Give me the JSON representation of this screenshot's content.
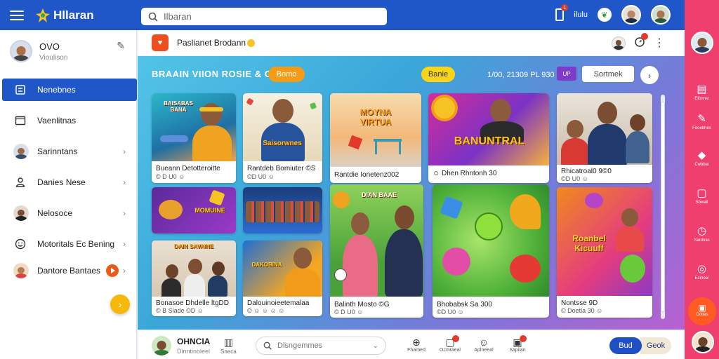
{
  "app": {
    "title": "Hllaran",
    "search_placeholder": "Ilbaran"
  },
  "topbar": {
    "notif_count": "1",
    "text_label": "ilulu"
  },
  "profile": {
    "name": "OVO",
    "subtitle": "Vioulison"
  },
  "sidebar": {
    "items": [
      {
        "label": "Nenebnes",
        "icon": "home-icon",
        "active": true
      },
      {
        "label": "Vaenlitnas",
        "icon": "window-icon"
      },
      {
        "label": "Sarinntans",
        "icon": "avatar"
      },
      {
        "label": "Danies Nese",
        "icon": "person-icon"
      },
      {
        "label": "Nelosoce",
        "icon": "avatar"
      },
      {
        "label": "Motoritals Ec Bening",
        "icon": "smile-icon"
      },
      {
        "label": "Dantore Bantaes",
        "icon": "avatar",
        "live": true
      }
    ]
  },
  "channel": {
    "title": "Paslianet Brodann"
  },
  "toolbar": {
    "banner": "BRAAIN VIION ROSIE & OG",
    "orange_pill": "Bomo",
    "yellow_pill": "Banie",
    "date": "1/00, 21309 PL 930",
    "purple_btn": "UP",
    "sort_label": "Sortmek"
  },
  "cards": [
    {
      "thumb_title": "BAISABAS BANA",
      "caption": "Bueann Detotteroitte",
      "meta": "© D U0 ☺"
    },
    {
      "thumb_title": "Saisorwnes",
      "caption": "Rantdeb Bomiuter ©S",
      "meta": "©D U0 ☺"
    },
    {
      "thumb_title": "MOYNA VIRTUA",
      "caption": "Rantdie Ionetenz002",
      "meta": ""
    },
    {
      "thumb_title": "BANUNTRAL",
      "caption": "☺ Dhen Rhntonh 30",
      "meta": ""
    },
    {
      "thumb_title": "",
      "caption": "Rhicatroal0 9©0",
      "meta": "©D U0 ☺"
    },
    {
      "thumb_title": "MOMUINE",
      "caption": "",
      "meta": ""
    },
    {
      "thumb_title": "",
      "caption": "",
      "meta": ""
    },
    {
      "thumb_title": "DAIN SAVAINE",
      "caption": "Bonasoe Dhdelle ltgDD",
      "meta": "© B Slade ©D ☺"
    },
    {
      "thumb_title": "DAKOBINA",
      "caption": "Dalouinoieetemalaa",
      "meta": "© ☺ ☺ ☺ ☺"
    },
    {
      "thumb_title": "DIAN BAAE",
      "caption": "Balinth Mosto ©G",
      "meta": "© D U0 ☺"
    },
    {
      "thumb_title": "",
      "caption": "Bhobabsk Sa 300",
      "meta": "©D U0 ☺"
    },
    {
      "thumb_title": "Roanbel Kicuuff",
      "caption": "Nontsse 9D",
      "meta": "© Doetla 30 ☺"
    }
  ],
  "bottombar": {
    "name": "OHNCIA",
    "sub": "Dinntinoleel",
    "store_label": "Sneca",
    "search_placeholder": "Dlsngemmes",
    "icons": [
      {
        "label": "Fhamed",
        "icon": "ball-icon"
      },
      {
        "label": "Ocmtaeal",
        "icon": "chat-icon"
      },
      {
        "label": "Aplneeal",
        "icon": "smile-icon"
      },
      {
        "label": "Sapilan",
        "icon": "calendar-icon"
      }
    ],
    "primary_btn": "Bud",
    "secondary_btn": "Geok"
  },
  "rightbar": {
    "items": [
      {
        "label": "Efonnst",
        "icon": "document-icon"
      },
      {
        "label": "Fooebhes",
        "icon": "pen-icon"
      },
      {
        "label": "Cwbbat",
        "icon": "chat-icon"
      },
      {
        "label": "Sbwall",
        "icon": "frame-icon"
      },
      {
        "label": "Sardnas",
        "icon": "clock-icon"
      },
      {
        "label": "Ecinoal",
        "icon": "chat-icon"
      }
    ],
    "active_label": "Dotlas"
  },
  "colors": {
    "topbar": "#1f57c8",
    "accent_orange": "#f59c16",
    "rightbar": "#ef3f6f",
    "active_nav": "#1f57c8"
  }
}
